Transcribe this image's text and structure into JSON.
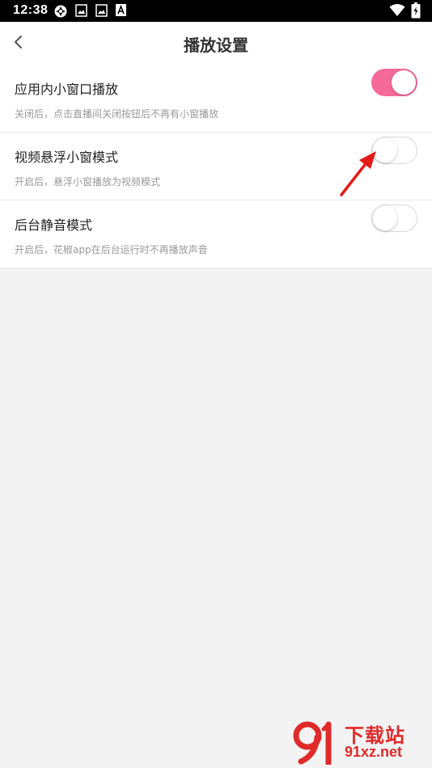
{
  "status_bar": {
    "time": "12:38",
    "icons": [
      "sync-icon",
      "image-icon",
      "image-icon",
      "a-icon",
      "wifi-icon",
      "battery-charging-icon"
    ]
  },
  "header": {
    "title": "播放设置",
    "back_icon": "chevron-left-icon"
  },
  "settings": [
    {
      "title": "应用内小窗口播放",
      "description": "关闭后，点击直播间关闭按钮后不再有小窗播放",
      "enabled": true
    },
    {
      "title": "视频悬浮小窗模式",
      "description": "开启后，悬浮小窗播放为视频模式",
      "enabled": false
    },
    {
      "title": "后台静音模式",
      "description": "开启后，花椒app在后台运行时不再播放声音",
      "enabled": false
    }
  ],
  "colors": {
    "accent": "#f56a98",
    "annotation_arrow": "#e31b1b",
    "watermark": "#e02a2a"
  },
  "watermark": {
    "chinese": "下载站",
    "url": "91xz.net"
  }
}
